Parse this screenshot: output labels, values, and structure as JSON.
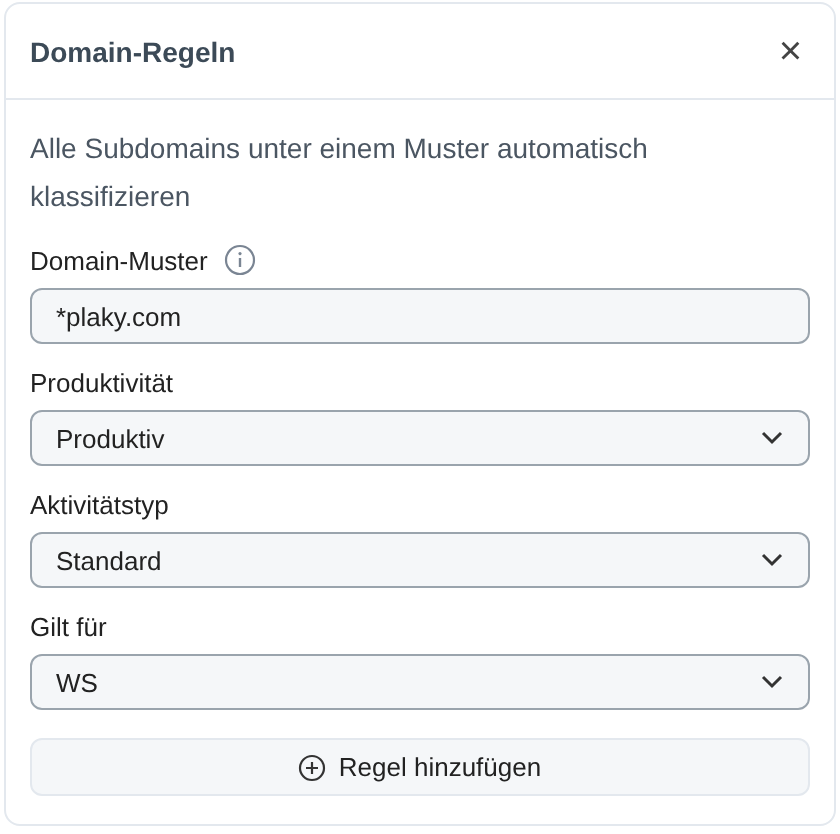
{
  "dialog": {
    "title": "Domain-Regeln",
    "close": "×"
  },
  "description": "Alle Subdomains unter einem Muster automatisch klassifizieren",
  "fields": [
    {
      "kind": "text",
      "label": "Domain-Muster",
      "info": true,
      "value": "*plaky.com"
    },
    {
      "kind": "select",
      "label": "Produktivität",
      "info": false,
      "value": "Produktiv"
    },
    {
      "kind": "select",
      "label": "Aktivitätstyp",
      "info": false,
      "value": "Standard"
    },
    {
      "kind": "select",
      "label": "Gilt für",
      "info": false,
      "value": "WS"
    }
  ],
  "add_button": "Regel hinzufügen"
}
